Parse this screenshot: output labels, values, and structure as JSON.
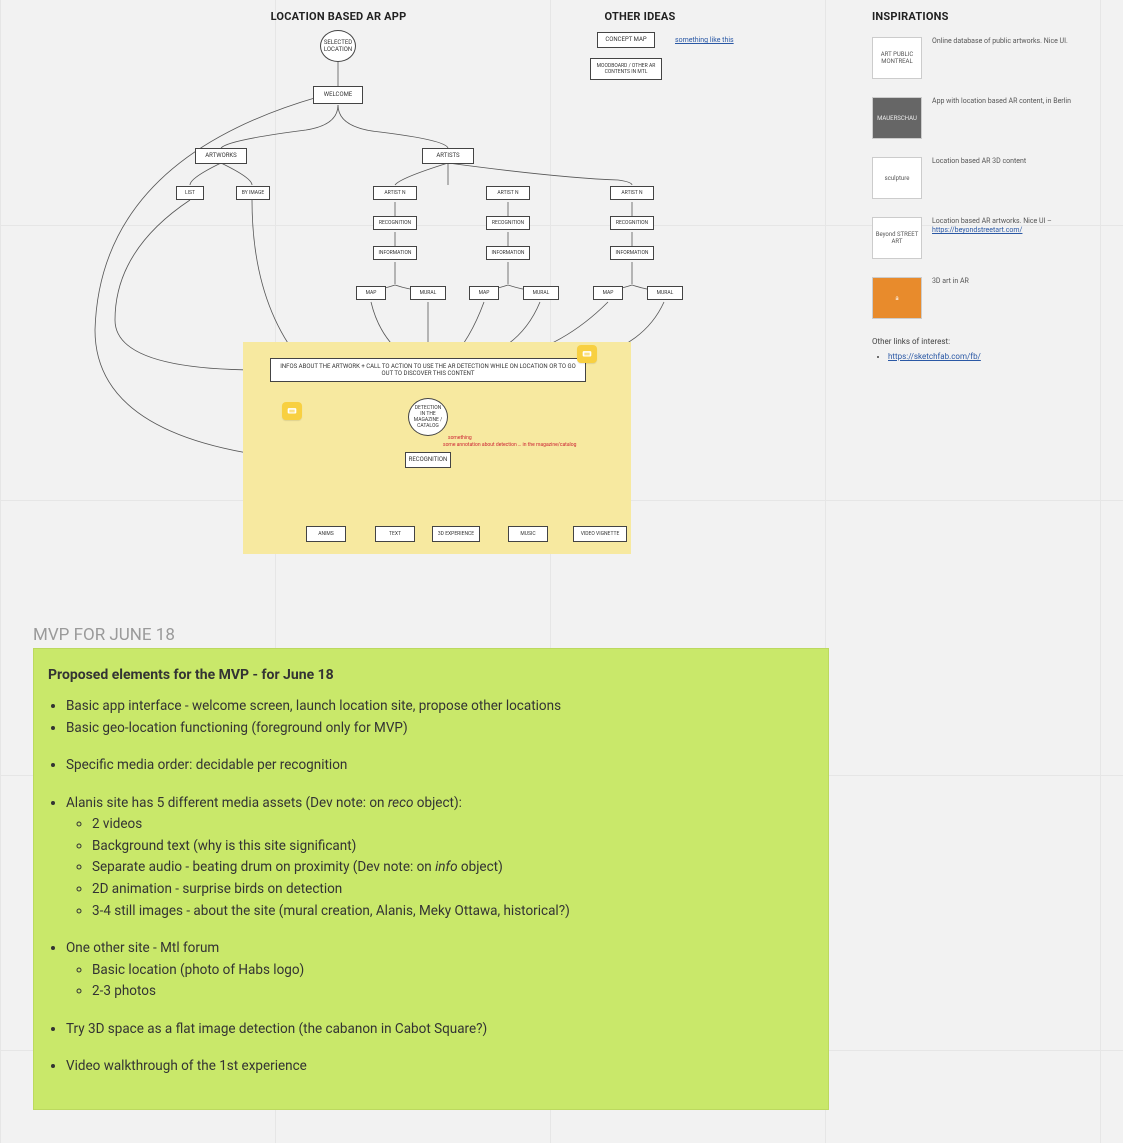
{
  "headings": {
    "app": "LOCATION BASED AR APP",
    "other": "OTHER IDEAS",
    "insp": "INSPIRATIONS"
  },
  "flow": {
    "root": "SELECTED LOCATION",
    "welcome": "WELCOME",
    "artworks": "ARTWORKS",
    "artists": "ARTISTS",
    "list": "LIST",
    "byimage": "BY IMAGE",
    "artistN": "ARTIST N",
    "recoN": "RECOGNITION",
    "info": "INFORMATION",
    "map": "MAP",
    "mural": "MURAL",
    "call": "INFOS ABOUT THE ARTWORK + CALL TO ACTION TO USE THE AR DETECTION WHILE ON LOCATION OR TO GO OUT TO DISCOVER THIS CONTENT",
    "oval": "DETECTION IN THE MAGAZINE / CATALOG",
    "reco": "RECOGNITION",
    "leaves": [
      "ANIMS",
      "TEXT",
      "3D EXPERIENCE",
      "MUSIC",
      "VIDEO VIGNETTE"
    ],
    "redline1": "something",
    "redline2": "some annotation about detection … in the magazine/catalog"
  },
  "other_ideas": {
    "box1": "CONCEPT MAP",
    "box2": "MOODBOARD / OTHER AR CONTENTS IN MTL",
    "link": "something like this"
  },
  "insp": [
    {
      "thumb": "ART PUBLIC MONTREAL",
      "thumbClass": "",
      "text": "Online database of public artworks. Nice UI."
    },
    {
      "thumb": "MAUERSCHAU",
      "thumbClass": "dark",
      "text": "App with location based AR content, in Berlin"
    },
    {
      "thumb": "sculpture",
      "thumbClass": "",
      "text": "Location based AR 3D content"
    },
    {
      "thumb": "Beyond STREET ART",
      "thumbClass": "",
      "text": "Location based AR artworks. Nice UI – ",
      "link": "https://beyondstreetart.com/"
    },
    {
      "thumb": "a",
      "thumbClass": "amazon",
      "text": "3D art in AR"
    }
  ],
  "other_links_label": "Other links of interest:",
  "other_links": [
    "https://sketchfab.com/fb/"
  ],
  "mvp": {
    "label": "MVP FOR JUNE 18",
    "title": "Proposed elements for the MVP - for June 18",
    "items": [
      "Basic app interface - welcome screen, launch location site, propose other locations",
      "Basic geo-location functioning (foreground only for MVP)"
    ],
    "items2": [
      "Specific media order: decidable per recognition"
    ],
    "alanis_pre": "Alanis site has 5 different media assets (Dev note: on ",
    "alanis_em1": "reco",
    "alanis_post": " object):",
    "alanis_sub": [
      "2 videos",
      "Background text (why is this site significant)",
      {
        "pre": "Separate audio - beating drum on proximity (Dev note: on ",
        "em": "info",
        "post": " object)"
      },
      "2D animation - surprise birds on detection",
      "3-4 still images - about the site (mural creation, Alanis, Meky Ottawa, historical?)"
    ],
    "other_site": "One other site - Mtl forum",
    "other_sub": [
      "Basic location (photo of Habs logo)",
      "2-3 photos"
    ],
    "tail": [
      "Try 3D space as a flat image detection (the cabanon in Cabot Square?)",
      "Video walkthrough of the 1st experience"
    ]
  }
}
